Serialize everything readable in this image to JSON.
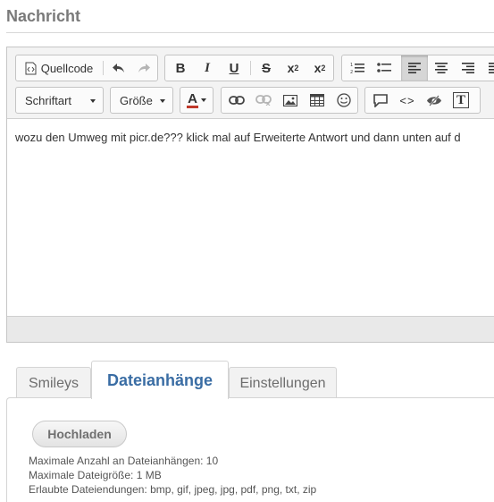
{
  "section_title": "Nachricht",
  "toolbar": {
    "source_label": "Quellcode",
    "font_combo": "Schriftart",
    "size_combo": "Größe",
    "text_color_letter": "A",
    "bold": "B",
    "italic": "I",
    "underline": "U",
    "strike": "S",
    "subscript_base": "x",
    "subscript_mark": "2",
    "superscript_base": "x",
    "superscript_mark": "2",
    "code_label": "<>",
    "text_label": "T"
  },
  "editor": {
    "content": "wozu den Umweg mit picr.de??? klick mal auf Erweiterte Antwort und dann unten auf d"
  },
  "tabs": [
    {
      "label": "Smileys",
      "active": false
    },
    {
      "label": "Dateianhänge",
      "active": true
    },
    {
      "label": "Einstellungen",
      "active": false
    }
  ],
  "attachments": {
    "upload_label": "Hochladen",
    "max_count": "Maximale Anzahl an Dateianhängen: 10",
    "max_size": "Maximale Dateigröße: 1 MB",
    "extensions": "Erlaubte Dateiendungen: bmp, gif, jpeg, jpg, pdf, png, txt, zip"
  },
  "colors": {
    "active_tab_text": "#3a6da4",
    "title_text": "#7a7a7a",
    "text_color_underline": "#c0392b"
  }
}
